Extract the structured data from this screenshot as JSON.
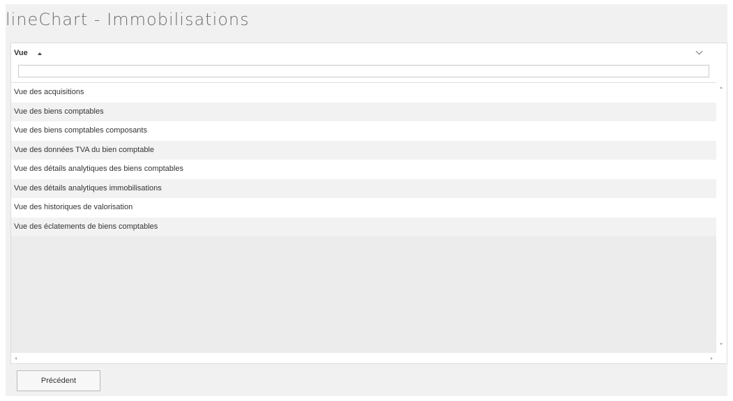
{
  "page": {
    "title": "lineChart - Immobilisations"
  },
  "grid": {
    "column": {
      "label": "Vue",
      "sort": "ascending"
    },
    "filter": {
      "value": "",
      "placeholder": ""
    },
    "rows": [
      "Vue des acquisitions",
      "Vue des biens comptables",
      "Vue des biens comptables composants",
      "Vue des données TVA du bien comptable",
      "Vue des détails analytiques des biens comptables",
      "Vue des détails analytiques immobilisations",
      "Vue des historiques de valorisation",
      "Vue des éclatements de biens comptables"
    ]
  },
  "footer": {
    "prev_label": "Précédent"
  },
  "icons": {
    "sort": "sort-ascending-icon",
    "dropdown": "chevron-down-icon",
    "scroll_up": "scroll-up-icon",
    "scroll_down": "scroll-down-icon",
    "scroll_left": "scroll-left-icon",
    "scroll_right": "scroll-right-icon"
  }
}
